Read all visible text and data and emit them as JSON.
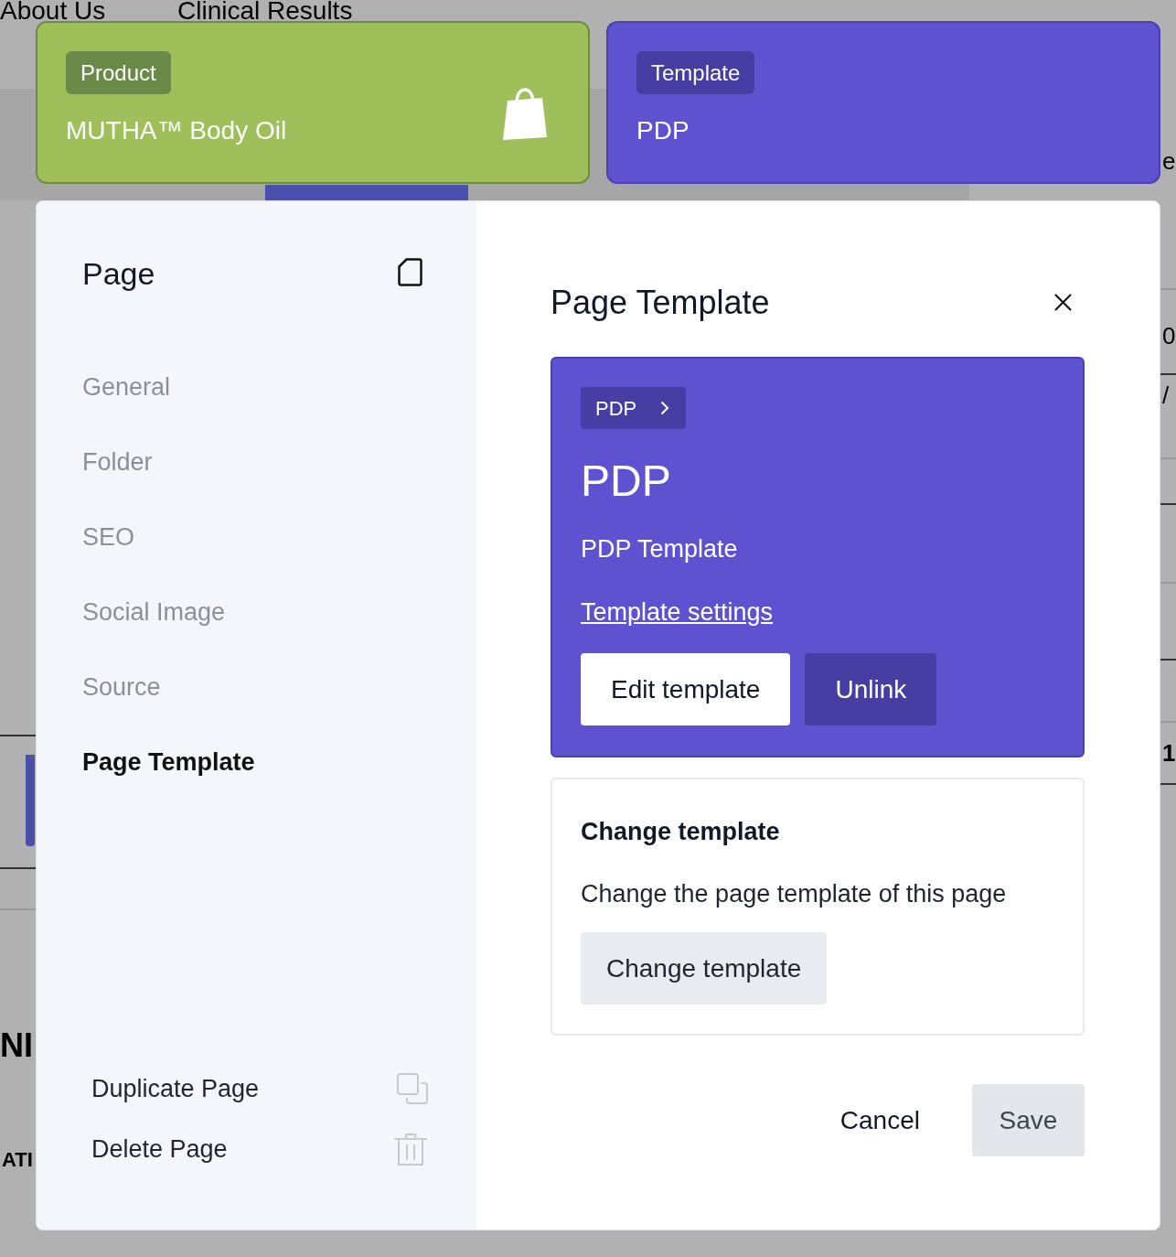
{
  "background_page": {
    "menu_links": [
      "About Us",
      "Clinical Results"
    ],
    "right_edge_fragments": [
      "e",
      "0",
      "/",
      "1"
    ],
    "left_edge_fragments": [
      "NI",
      "ATI"
    ]
  },
  "context_cards": [
    {
      "kind": "product",
      "label": "Product",
      "title": "MUTHA™ Body Oil",
      "color": "#9ebf5a"
    },
    {
      "kind": "template",
      "label": "Template",
      "title": "PDP",
      "color": "#5f52d1"
    }
  ],
  "dialog": {
    "sidebar": {
      "title": "Page",
      "items": [
        {
          "label": "General",
          "selected": false
        },
        {
          "label": "Folder",
          "selected": false
        },
        {
          "label": "SEO",
          "selected": false
        },
        {
          "label": "Social Image",
          "selected": false
        },
        {
          "label": "Source",
          "selected": false
        },
        {
          "label": "Page Template",
          "selected": true
        }
      ],
      "actions": [
        {
          "kind": "duplicate",
          "label": "Duplicate Page"
        },
        {
          "kind": "delete",
          "label": "Delete Page"
        }
      ]
    },
    "title": "Page Template",
    "linked_template": {
      "breadcrumb": "PDP",
      "name": "PDP",
      "description": "PDP Template",
      "settings_link": "Template settings",
      "buttons": [
        {
          "kind": "primary",
          "label": "Edit template"
        },
        {
          "kind": "secondary",
          "label": "Unlink"
        }
      ]
    },
    "change_template": {
      "title": "Change template",
      "description": "Change the page template of this page",
      "button": "Change template"
    },
    "footer": {
      "cancel": "Cancel",
      "save": {
        "label": "Save",
        "disabled": true
      }
    }
  }
}
